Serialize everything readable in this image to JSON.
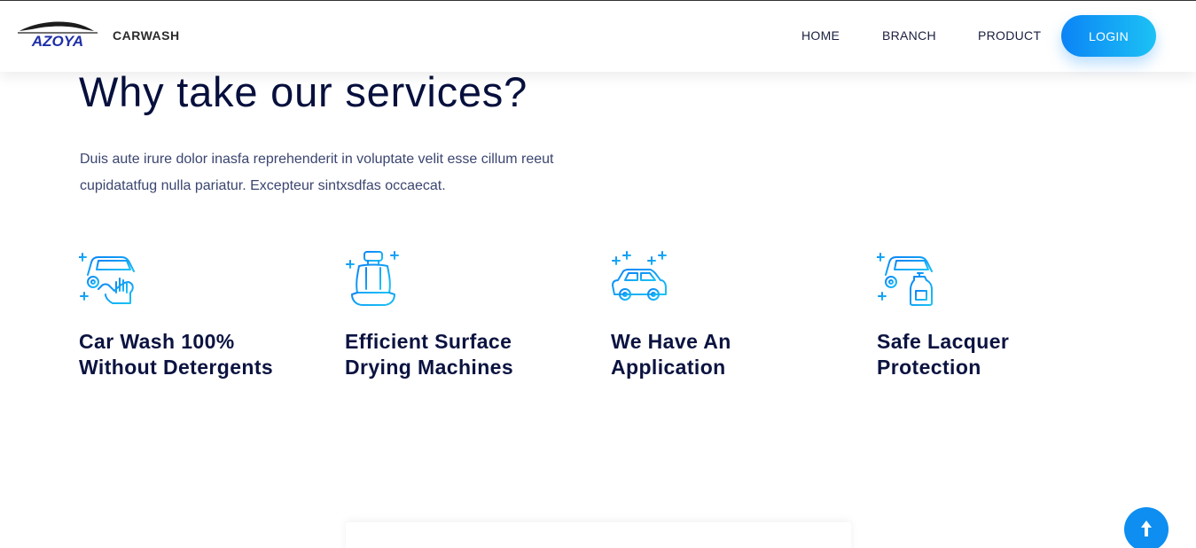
{
  "header": {
    "logo_text": "AZOYA",
    "brand_name": "CARWASH",
    "nav": {
      "home": "HOME",
      "branch": "BRANCH",
      "product": "PRODUCT"
    },
    "login_label": "LOGIN"
  },
  "section": {
    "title": "Why take our services?",
    "description": "Duis aute irure dolor inasfa reprehenderit in voluptate velit esse cillum reeut cupidatatfug nulla pariatur. Excepteur sintxsdfas occaecat.",
    "features": [
      {
        "icon": "car-wash-hand-icon",
        "title": "Car Wash 100% Without Detergents"
      },
      {
        "icon": "car-seat-icon",
        "title": "Efficient Surface Drying Machines"
      },
      {
        "icon": "car-sparkle-icon",
        "title": "We Have An Application"
      },
      {
        "icon": "car-spray-bottle-icon",
        "title": "Safe Lacquer Protection"
      }
    ]
  },
  "colors": {
    "accent": "#0d8ef0",
    "accent_light": "#1cc2f5",
    "heading": "#07103d",
    "body_text": "#3b4570"
  },
  "scroll_top_icon": "arrow-up-icon"
}
